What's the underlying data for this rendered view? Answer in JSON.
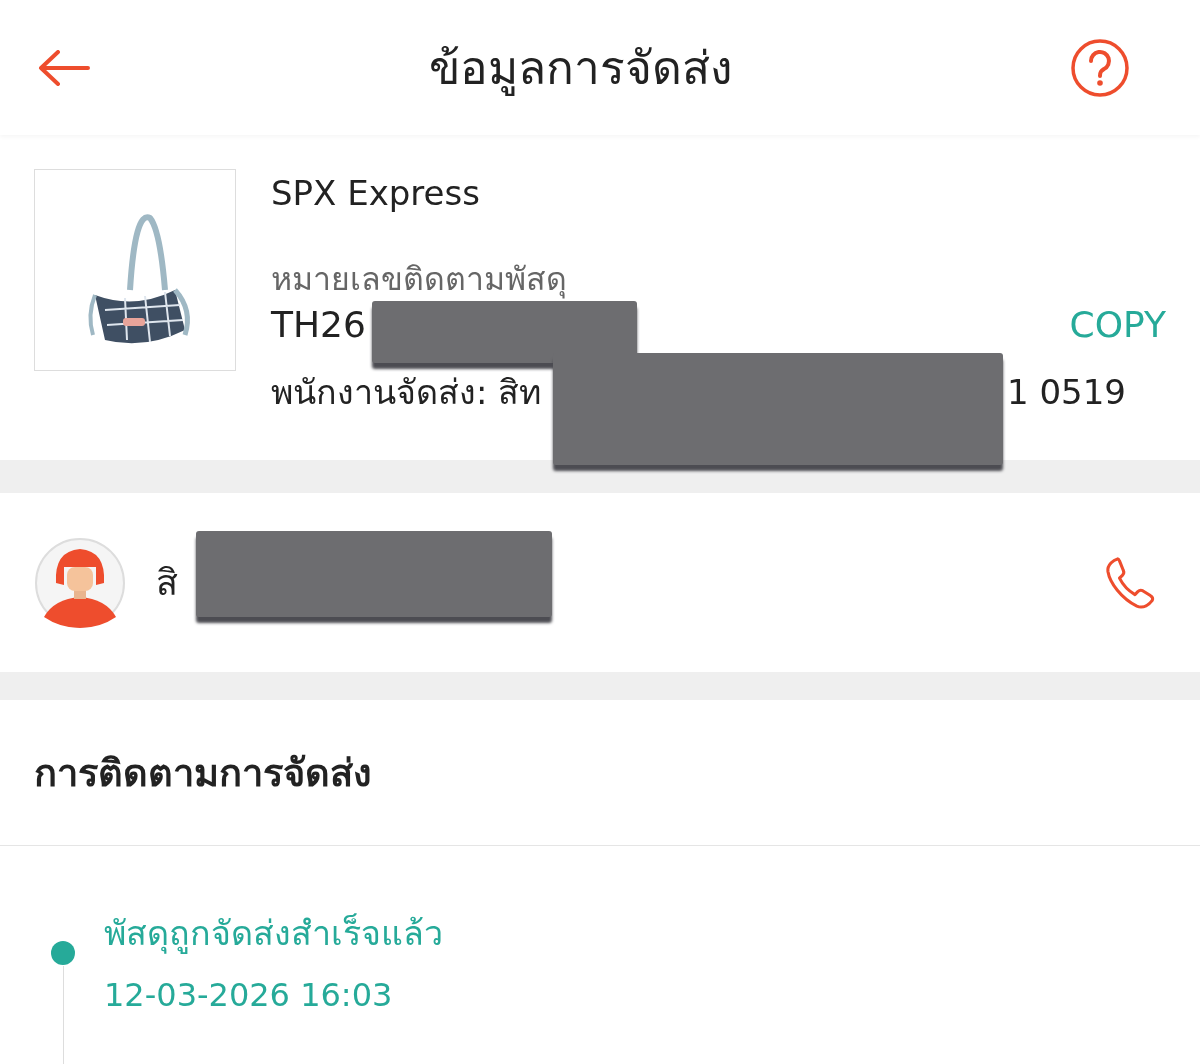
{
  "header": {
    "title": "ข้อมูลการจัดส่ง"
  },
  "shipment": {
    "carrier": "SPX Express",
    "tracking_label": "หมายเลขติดตามพัสดุ",
    "tracking_number": "TH26",
    "copy_button": "COPY",
    "courier_line": "พนักงานจัดส่ง: สิท",
    "courier_phone_tail": "1 0519"
  },
  "courier": {
    "name": "สิ"
  },
  "tracking": {
    "title": "การติดตามการจัดส่ง",
    "events": [
      {
        "status": "พัสดุถูกจัดส่งสำเร็จแล้ว",
        "time": "12-03-2026 16:03",
        "selected": true
      }
    ]
  }
}
